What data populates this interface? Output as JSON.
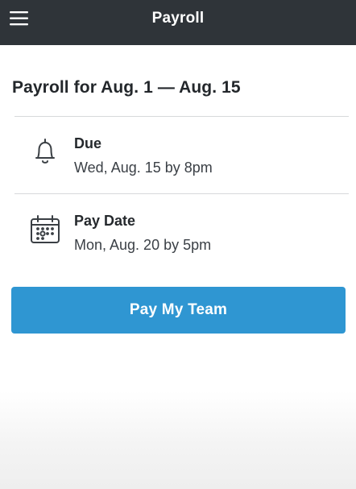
{
  "app_bar": {
    "title": "Payroll",
    "menu_icon": "hamburger-menu-icon",
    "background": "#2f3439"
  },
  "period": {
    "title": "Payroll for Aug. 1 — Aug. 15"
  },
  "due": {
    "icon": "bell-icon",
    "label": "Due",
    "value": "Wed, Aug. 15 by 8pm"
  },
  "pay_date": {
    "icon": "calendar-icon",
    "label": "Pay Date",
    "value": "Mon, Aug. 20 by 5pm"
  },
  "action": {
    "pay_label": "Pay My Team",
    "color": "#2f96d2"
  }
}
